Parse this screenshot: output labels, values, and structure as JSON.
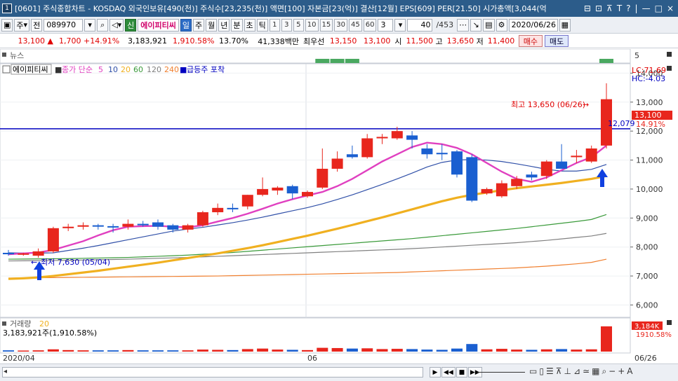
{
  "window": {
    "icon": "1",
    "title": "[0601] 주식종합차트 - KOSDAQ 외국인보유[490(천)] 주식수[23,235(천)] 액면[100] 자본금[23(억)] 결산[12월] EPS[609] PER[21.50] 시가총액[3,044(억",
    "buttons": [
      "⊟",
      "⊡",
      "⊼",
      "T",
      "?",
      "|",
      "—",
      "□",
      "×"
    ]
  },
  "toolbar": {
    "mode_label": "주",
    "period_label": "전",
    "code": "089970",
    "badge": "신",
    "stock_name": "에이피티씨",
    "intervals": [
      "일",
      "주",
      "월",
      "년",
      "분",
      "초",
      "틱"
    ],
    "active_interval": "일",
    "minute_steps": [
      "1",
      "3",
      "5",
      "10",
      "15",
      "30",
      "45",
      "60"
    ],
    "count_value": "3",
    "page_value": "40",
    "page_total": "/453",
    "date": "2020/06/26"
  },
  "quote": {
    "price": "13,100 ▲",
    "change": "1,700 +14.91%",
    "volume": "3,183,921",
    "vol_ratio": "1,910.58%",
    "turnover": "13.70%",
    "amount": "41,338백만",
    "best_label": "최우선",
    "ask": "13,150",
    "bid": "13,100",
    "open_label": "시",
    "open": "11,500",
    "high_label": "고",
    "high": "13,650",
    "low_label": "저",
    "low": "11,400",
    "buy_btn": "매수",
    "sell_btn": "매도"
  },
  "chart_labels": {
    "news_label": "뉴스",
    "news_axis": "5",
    "legend_name": "에이피티씨",
    "legend_ma": "종가 단순",
    "legend_periods": [
      "5",
      "10",
      "20",
      "60",
      "120",
      "240"
    ],
    "legend_extra": "급등주 포착",
    "lc": "LC:71.69",
    "hc": "HC:-4.03",
    "high_annot": "최고 13,650 (06/26)",
    "low_annot": "최저 7,630 (05/04)",
    "price_tag": "13,100",
    "pct_tag": "14.91%",
    "hline_tag": "12,079",
    "vol_label": "거래량",
    "vol_period": "20",
    "vol_info": "3,183,921주(1,910.58%)",
    "vol_tag": "3,184K",
    "vol_pct": "1910.58%",
    "date_left": "2020/04",
    "date_mid": "06",
    "date_right": "06/26"
  },
  "colors": {
    "up": "#e8261d",
    "down": "#1a5fd0",
    "ma5": "#e040c0",
    "ma10": "#3050a8",
    "ma20": "#f0b020",
    "ma60": "#3a9a3a",
    "ma120": "#808080",
    "ma240": "#f08030",
    "hline": "#0000c0"
  },
  "chart_data": {
    "type": "candlestick",
    "y_ticks": [
      6000,
      7000,
      8000,
      9000,
      10000,
      11000,
      12000,
      13000,
      14000
    ],
    "ylim": [
      5600,
      14300
    ],
    "horizontal_line": 12079,
    "candles": [
      {
        "o": 7800,
        "h": 7900,
        "l": 7700,
        "c": 7750
      },
      {
        "o": 7750,
        "h": 7800,
        "l": 7700,
        "c": 7780
      },
      {
        "o": 7700,
        "h": 7950,
        "l": 7630,
        "c": 7850
      },
      {
        "o": 7850,
        "h": 8700,
        "l": 7800,
        "c": 8650
      },
      {
        "o": 8650,
        "h": 8800,
        "l": 8550,
        "c": 8700
      },
      {
        "o": 8700,
        "h": 8850,
        "l": 8600,
        "c": 8750
      },
      {
        "o": 8750,
        "h": 8800,
        "l": 8600,
        "c": 8720
      },
      {
        "o": 8720,
        "h": 8800,
        "l": 8500,
        "c": 8700
      },
      {
        "o": 8700,
        "h": 8950,
        "l": 8600,
        "c": 8800
      },
      {
        "o": 8800,
        "h": 8900,
        "l": 8700,
        "c": 8750
      },
      {
        "o": 8850,
        "h": 8950,
        "l": 8600,
        "c": 8700
      },
      {
        "o": 8750,
        "h": 8800,
        "l": 8500,
        "c": 8600
      },
      {
        "o": 8600,
        "h": 8800,
        "l": 8500,
        "c": 8750
      },
      {
        "o": 8750,
        "h": 9250,
        "l": 8700,
        "c": 9200
      },
      {
        "o": 9200,
        "h": 9500,
        "l": 9100,
        "c": 9350
      },
      {
        "o": 9350,
        "h": 9500,
        "l": 9200,
        "c": 9300
      },
      {
        "o": 9400,
        "h": 9800,
        "l": 9300,
        "c": 9800
      },
      {
        "o": 9800,
        "h": 10400,
        "l": 9750,
        "c": 10000
      },
      {
        "o": 9950,
        "h": 10100,
        "l": 9800,
        "c": 10050
      },
      {
        "o": 10100,
        "h": 10150,
        "l": 9650,
        "c": 9850
      },
      {
        "o": 9750,
        "h": 9950,
        "l": 9700,
        "c": 9900
      },
      {
        "o": 10050,
        "h": 11400,
        "l": 10000,
        "c": 10700
      },
      {
        "o": 10700,
        "h": 11300,
        "l": 10600,
        "c": 11050
      },
      {
        "o": 11200,
        "h": 11500,
        "l": 11050,
        "c": 11100
      },
      {
        "o": 11100,
        "h": 11900,
        "l": 11050,
        "c": 11750
      },
      {
        "o": 11750,
        "h": 11900,
        "l": 11550,
        "c": 11800
      },
      {
        "o": 11750,
        "h": 12150,
        "l": 11700,
        "c": 12000
      },
      {
        "o": 11850,
        "h": 12000,
        "l": 11400,
        "c": 11700
      },
      {
        "o": 11400,
        "h": 11550,
        "l": 11050,
        "c": 11200
      },
      {
        "o": 11250,
        "h": 11550,
        "l": 11000,
        "c": 11200
      },
      {
        "o": 11300,
        "h": 11350,
        "l": 10400,
        "c": 10500
      },
      {
        "o": 11100,
        "h": 11200,
        "l": 9550,
        "c": 9600
      },
      {
        "o": 9850,
        "h": 10050,
        "l": 9800,
        "c": 10000
      },
      {
        "o": 9750,
        "h": 10300,
        "l": 9700,
        "c": 10200
      },
      {
        "o": 10100,
        "h": 10450,
        "l": 10000,
        "c": 10350
      },
      {
        "o": 10500,
        "h": 10600,
        "l": 10300,
        "c": 10400
      },
      {
        "o": 10450,
        "h": 11000,
        "l": 10350,
        "c": 10950
      },
      {
        "o": 10950,
        "h": 11550,
        "l": 10800,
        "c": 10700
      },
      {
        "o": 11100,
        "h": 11350,
        "l": 10900,
        "c": 11150
      },
      {
        "o": 10950,
        "h": 11500,
        "l": 10900,
        "c": 11400
      },
      {
        "o": 11500,
        "h": 13650,
        "l": 11400,
        "c": 13100
      }
    ],
    "ma5": [
      7750,
      7780,
      7810,
      7900,
      8050,
      8200,
      8400,
      8580,
      8700,
      8720,
      8730,
      8700,
      8680,
      8750,
      8880,
      9000,
      9150,
      9320,
      9500,
      9650,
      9780,
      9900,
      10100,
      10350,
      10650,
      10950,
      11200,
      11450,
      11600,
      11550,
      11420,
      11200,
      10900,
      10600,
      10350,
      10250,
      10400,
      10650,
      10900,
      11100,
      11500
    ],
    "ma10": [
      7800,
      7790,
      7790,
      7800,
      7880,
      7960,
      8050,
      8150,
      8250,
      8350,
      8450,
      8550,
      8620,
      8680,
      8760,
      8840,
      8930,
      9030,
      9140,
      9250,
      9360,
      9490,
      9640,
      9800,
      9980,
      10160,
      10350,
      10550,
      10760,
      10920,
      11000,
      11020,
      11000,
      10950,
      10870,
      10780,
      10680,
      10620,
      10620,
      10680,
      10850
    ],
    "ma20": [
      6900,
      6920,
      6950,
      7000,
      7060,
      7120,
      7180,
      7250,
      7320,
      7390,
      7460,
      7540,
      7620,
      7700,
      7780,
      7870,
      7960,
      8060,
      8170,
      8280,
      8390,
      8510,
      8630,
      8760,
      8890,
      9020,
      9160,
      9300,
      9440,
      9580,
      9700,
      9800,
      9880,
      9960,
      10030,
      10090,
      10150,
      10210,
      10280,
      10350,
      10450
    ],
    "ma60": [
      7580,
      7585,
      7590,
      7595,
      7600,
      7610,
      7620,
      7630,
      7640,
      7660,
      7680,
      7700,
      7720,
      7750,
      7780,
      7810,
      7850,
      7890,
      7930,
      7970,
      8010,
      8050,
      8090,
      8130,
      8170,
      8210,
      8250,
      8290,
      8340,
      8390,
      8440,
      8490,
      8540,
      8590,
      8640,
      8700,
      8760,
      8820,
      8880,
      8950,
      9120
    ],
    "ma120": [
      7520,
      7525,
      7530,
      7535,
      7540,
      7550,
      7560,
      7570,
      7580,
      7595,
      7610,
      7625,
      7640,
      7660,
      7680,
      7700,
      7720,
      7740,
      7760,
      7780,
      7800,
      7820,
      7840,
      7860,
      7880,
      7900,
      7920,
      7945,
      7970,
      8000,
      8030,
      8060,
      8090,
      8120,
      8150,
      8190,
      8230,
      8280,
      8330,
      8380,
      8470
    ],
    "ma240": [
      6930,
      6935,
      6940,
      6945,
      6950,
      6955,
      6960,
      6965,
      6970,
      6975,
      6980,
      6985,
      6990,
      6995,
      7000,
      7010,
      7020,
      7030,
      7040,
      7050,
      7060,
      7070,
      7080,
      7090,
      7100,
      7110,
      7120,
      7140,
      7160,
      7180,
      7200,
      7220,
      7240,
      7260,
      7280,
      7310,
      7340,
      7380,
      7420,
      7470,
      7580
    ],
    "volumes": [
      0.05,
      0.04,
      0.05,
      0.09,
      0.06,
      0.05,
      0.05,
      0.05,
      0.06,
      0.05,
      0.05,
      0.05,
      0.05,
      0.08,
      0.07,
      0.06,
      0.1,
      0.12,
      0.08,
      0.07,
      0.06,
      0.15,
      0.14,
      0.12,
      0.13,
      0.1,
      0.11,
      0.1,
      0.08,
      0.07,
      0.12,
      0.3,
      0.09,
      0.11,
      0.08,
      0.07,
      0.09,
      0.1,
      0.08,
      0.09,
      1.0
    ],
    "news_marks": [
      21,
      22,
      23,
      40
    ]
  }
}
